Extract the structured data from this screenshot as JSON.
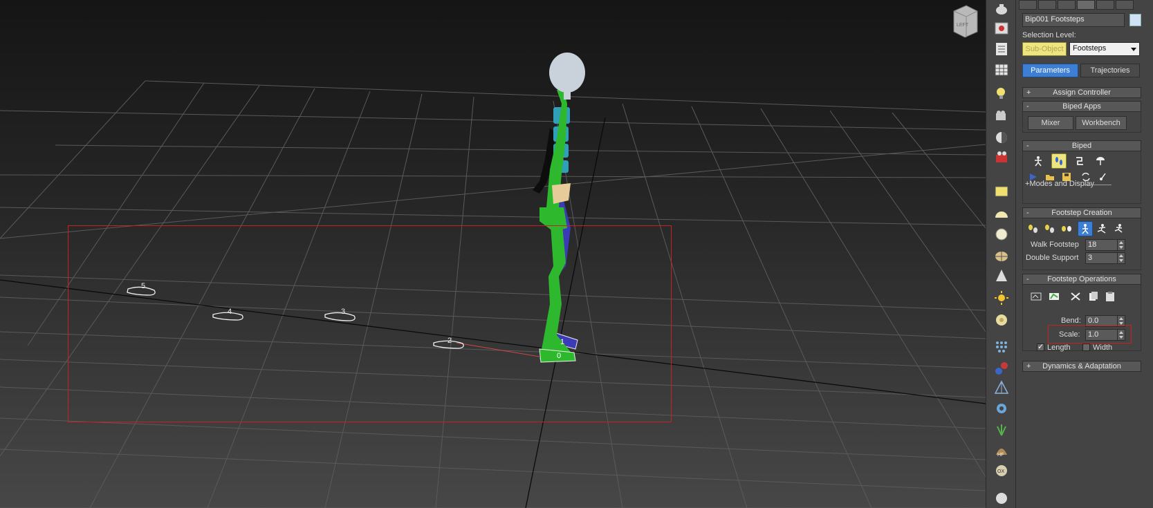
{
  "viewport": {
    "footprint_labels": [
      "5",
      "4",
      "3",
      "2",
      "1",
      "0"
    ],
    "viewcube_label": "LEFT"
  },
  "panel": {
    "object_name": "Bip001 Footsteps",
    "selection_level_label": "Selection Level:",
    "sub_object_label": "Sub-Object",
    "selection_level_value": "Footsteps",
    "tab_parameters": "Parameters",
    "tab_trajectories": "Trajectories",
    "rollouts": {
      "assign_controller": {
        "sign": "+",
        "title": "Assign Controller"
      },
      "biped_apps": {
        "sign": "-",
        "title": "Biped Apps",
        "mixer": "Mixer",
        "workbench": "Workbench"
      },
      "biped": {
        "sign": "-",
        "title": "Biped",
        "modes_display": "+Modes and Display"
      },
      "footstep_creation": {
        "sign": "-",
        "title": "Footstep Creation",
        "walk_footstep_label": "Walk Footstep",
        "walk_footstep_value": "18",
        "double_support_label": "Double Support",
        "double_support_value": "3"
      },
      "footstep_operations": {
        "sign": "-",
        "title": "Footstep Operations",
        "bend_label": "Bend:",
        "bend_value": "0.0",
        "scale_label": "Scale:",
        "scale_value": "1.0",
        "length_label": "Length",
        "width_label": "Width"
      },
      "dynamics": {
        "sign": "+",
        "title": "Dynamics & Adaptation"
      }
    }
  },
  "colors": {
    "selection_box": "#c62222",
    "active_tab": "#3e7fd6",
    "highlight_yellow": "#efe580",
    "biped_green": "#2db82d",
    "biped_blue": "#3b3bb8",
    "spine_cyan": "#2fa0b8",
    "head_grey": "#c9d1da"
  }
}
